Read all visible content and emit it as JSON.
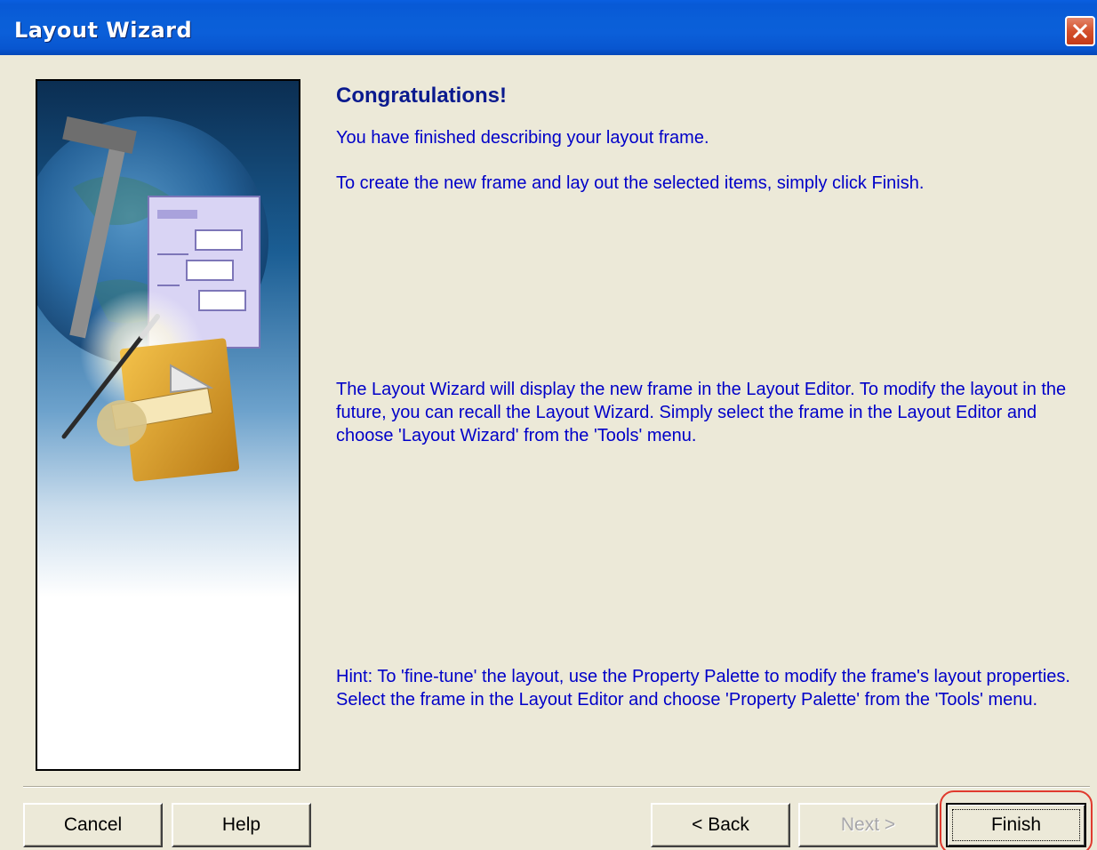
{
  "window": {
    "title": "Layout Wizard",
    "close_icon": "close-x-icon"
  },
  "content": {
    "heading": "Congratulations!",
    "paragraph_1": "You have finished describing your layout frame.",
    "paragraph_2": "To create the new frame and lay out the selected items, simply click Finish.",
    "paragraph_3": "The Layout Wizard will display the new frame in the Layout Editor. To modify the layout in the future, you can recall the Layout Wizard. Simply select the frame in the Layout Editor and choose 'Layout Wizard' from the 'Tools' menu.",
    "paragraph_4": "Hint: To 'fine-tune' the layout, use the Property Palette to modify the frame's layout properties. Select the frame in the Layout Editor and choose 'Property Palette' from the 'Tools' menu."
  },
  "buttons": {
    "cancel": "Cancel",
    "help": "Help",
    "back": "< Back",
    "next": "Next >",
    "finish": "Finish"
  },
  "colors": {
    "titlebar": "#0a5fd8",
    "dialog_bg": "#ece9d8",
    "heading": "#0a1a8e",
    "body_text": "#0000c8",
    "highlight": "#e03a2e"
  }
}
